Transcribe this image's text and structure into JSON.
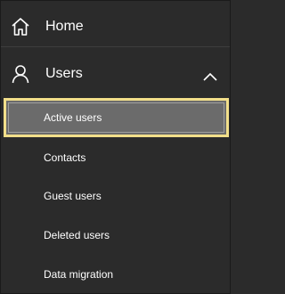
{
  "nav": {
    "home": {
      "label": "Home",
      "icon": "home-icon"
    },
    "users": {
      "label": "Users",
      "icon": "person-icon",
      "expanded": true,
      "chevron_icon": "chevron-up-icon"
    },
    "sub_items": {
      "active_users": "Active users",
      "contacts": "Contacts",
      "guest_users": "Guest users",
      "deleted_users": "Deleted users",
      "data_migration": "Data migration"
    },
    "selected": "Active users"
  },
  "colors": {
    "background": "#2b2b2b",
    "selected_background": "#6b6b6b",
    "highlight_border": "#f2df8a",
    "text": "#ffffff"
  }
}
